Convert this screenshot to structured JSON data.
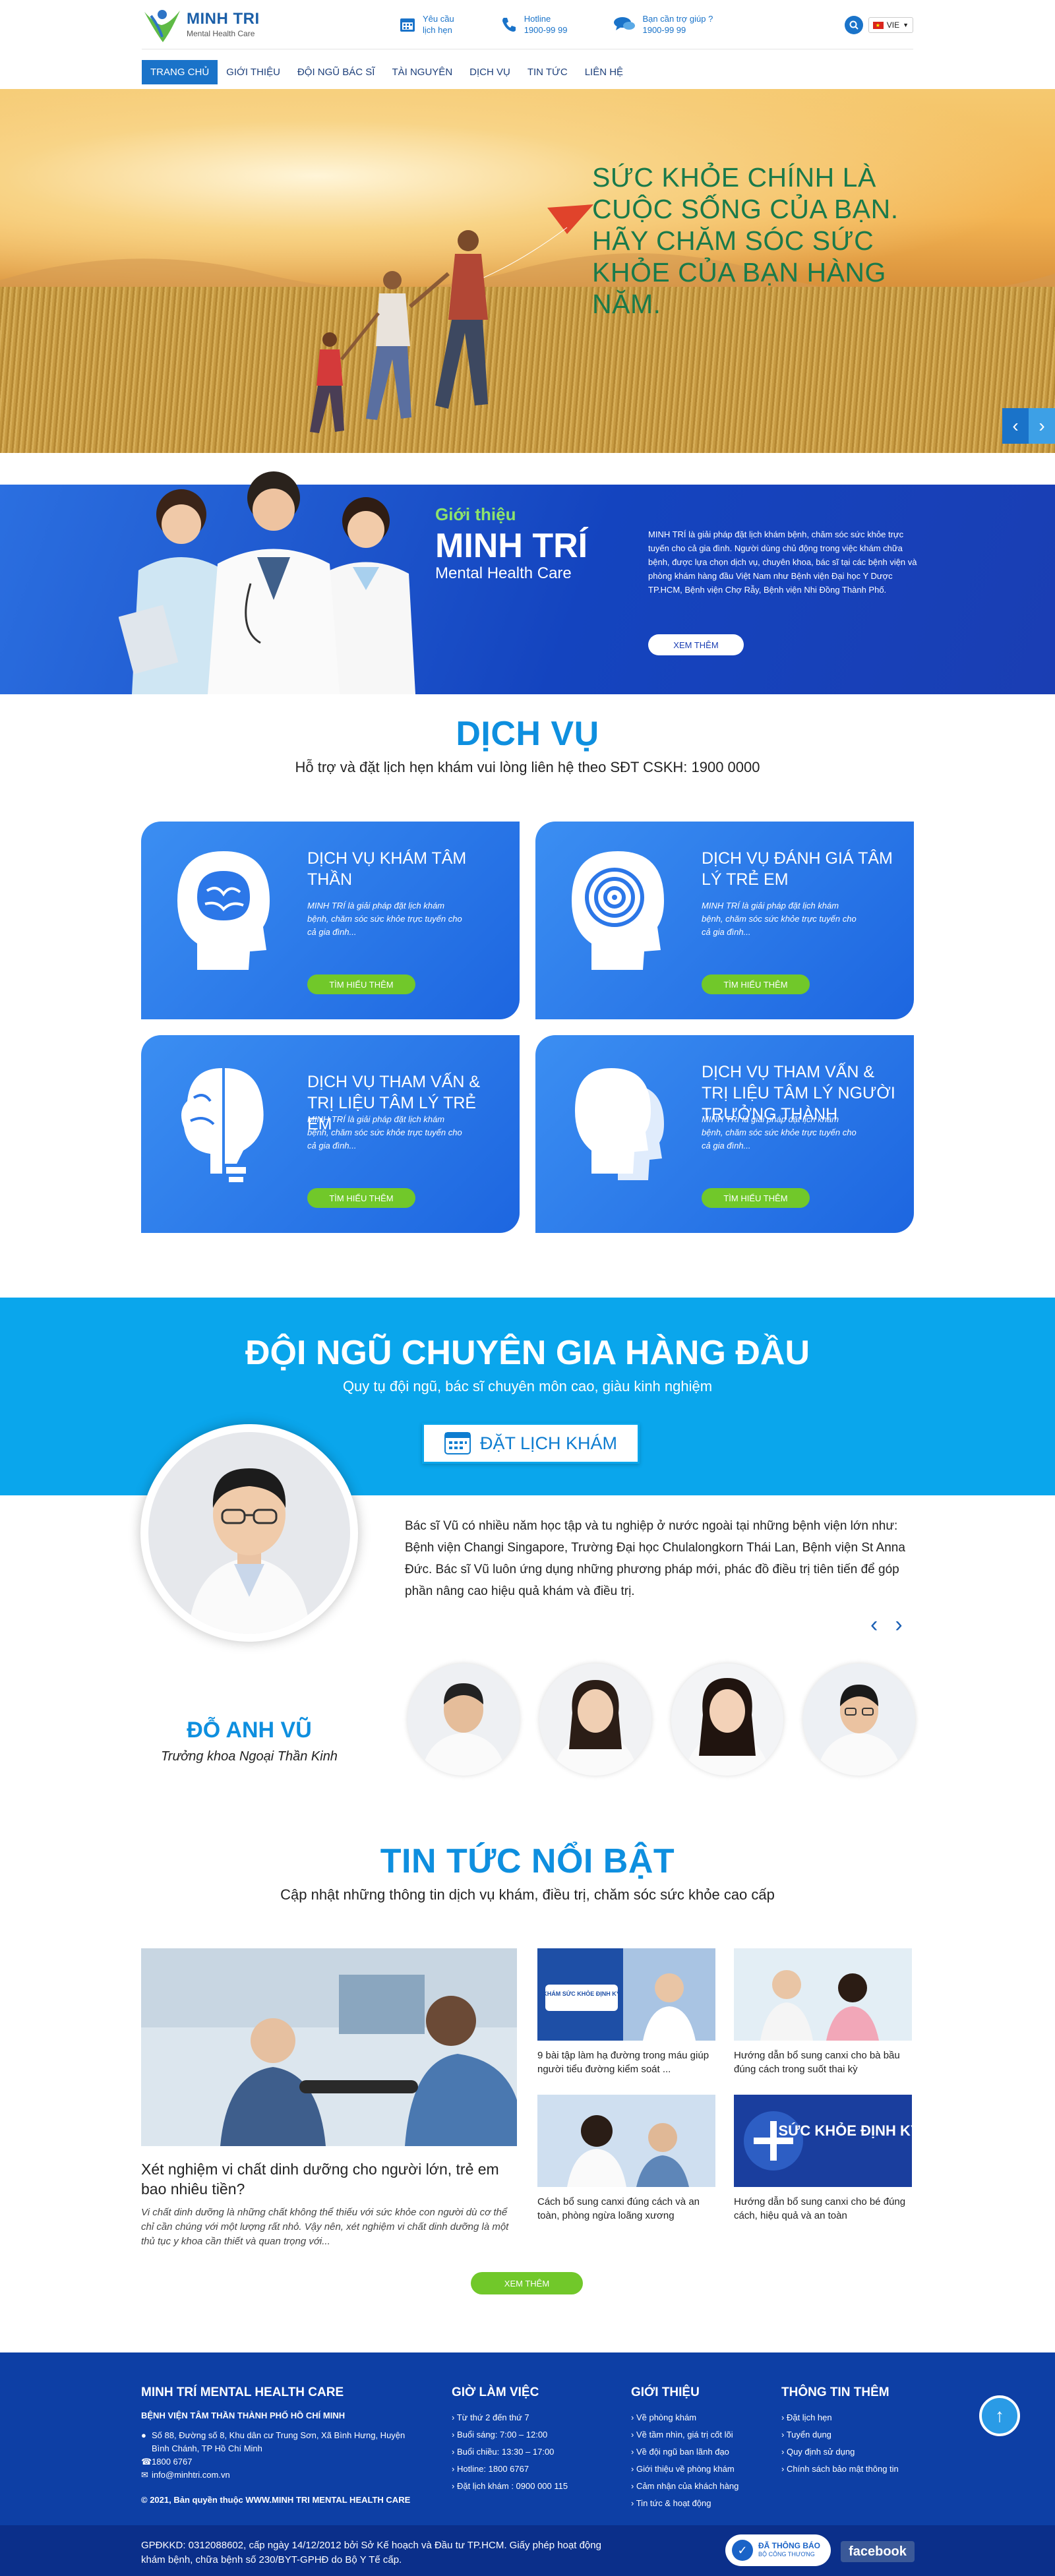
{
  "brand": {
    "name": "MINH TRI",
    "tagline": "Mental Health Care"
  },
  "header": {
    "contacts": [
      {
        "icon": "calendar-icon",
        "label": "Yêu cầu",
        "sub": "lịch hẹn"
      },
      {
        "icon": "phone-icon",
        "label": "Hotline",
        "sub": "1900-99 99"
      },
      {
        "icon": "chat-icon",
        "label": "Bạn cần trợ giúp ?",
        "sub": "1900-99 99"
      }
    ],
    "language": "VIE"
  },
  "nav": {
    "items": [
      "TRANG CHỦ",
      "GIỚI THIỆU",
      "ĐỘI NGŨ BÁC SĨ",
      "TÀI NGUYÊN",
      "DỊCH VỤ",
      "TIN TỨC",
      "LIÊN HỆ"
    ],
    "active": "TRANG CHỦ"
  },
  "hero": {
    "title": "SỨC KHỎE CHÍNH LÀ CUỘC SỐNG CỦA BẠN. HÃY CHĂM SÓC SỨC KHỎE CỦA BẠN HÀNG NĂM.",
    "prev": "‹",
    "next": "›"
  },
  "intro": {
    "label": "Giới thiệu",
    "title": "MINH TRÍ",
    "subtitle": "Mental Health Care",
    "description": "MINH TRÍ là giải pháp đặt lịch khám bệnh, chăm sóc sức khỏe trực tuyến cho cả gia đình. Người dùng chủ động trong việc khám chữa bệnh, được lựa chọn dịch vụ, chuyên khoa, bác sĩ tại các bệnh viện và phòng khám hàng đầu Việt Nam như Bệnh viện Đại học Y Dược TP.HCM, Bệnh viện Chợ Rẫy, Bệnh viện Nhi Đồng Thành Phố.",
    "button": "XEM THÊM"
  },
  "services": {
    "title": "DỊCH VỤ",
    "subtitle": "Hỗ trợ và đặt lịch hẹn khám vui lòng liên hệ theo SĐT CSKH: 1900 0000",
    "items": [
      {
        "name": "DỊCH VỤ KHÁM TÂM THẦN",
        "desc": "MINH TRÍ là giải pháp đặt lịch khám bệnh, chăm sóc sức khỏe trực tuyến cho cả gia đình...",
        "button": "TÌM HIỂU THÊM",
        "icon": "brain-head-icon"
      },
      {
        "name": "DỊCH VỤ ĐÁNH GIÁ TÂM LÝ TRẺ EM",
        "desc": "MINH TRÍ là giải pháp đặt lịch khám bệnh, chăm sóc sức khỏe trực tuyến cho cả gia đình...",
        "button": "TÌM HIỂU THÊM",
        "icon": "maze-head-icon"
      },
      {
        "name": "DỊCH VỤ THAM VẤN & TRỊ LIỆU TÂM LÝ TRẺ EM",
        "desc": "MINH TRÍ là giải pháp đặt lịch khám bệnh, chăm sóc sức khỏe trực tuyến cho cả gia đình...",
        "button": "TÌM HIỂU THÊM",
        "icon": "brain-bulb-icon"
      },
      {
        "name": "DỊCH VỤ THAM VẤN & TRỊ LIỆU TÂM LÝ NGƯỜI TRƯỞNG THÀNH",
        "desc": "MINH TRÍ là giải pháp đặt lịch khám bệnh, chăm sóc sức khỏe trực tuyến cho cả gia đình...",
        "button": "TÌM HIỂU THÊM",
        "icon": "two-heads-icon"
      }
    ]
  },
  "experts": {
    "title": "ĐỘI NGŨ CHUYÊN GIA HÀNG ĐẦU",
    "subtitle": "Quy tụ đội ngũ, bác sĩ chuyên môn cao, giàu kinh nghiệm",
    "book_button": "ĐẶT LỊCH KHÁM",
    "doctor": {
      "name": "ĐỖ ANH VŨ",
      "role": "Trưởng khoa Ngoại Thần Kinh",
      "bio": "Bác sĩ Vũ có nhiều năm học tập và tu nghiệp ở nước ngoài tại những bệnh viện lớn như: Bệnh viện Changi Singapore, Trường Đại học Chulalongkorn Thái Lan, Bệnh viện St Anna Đức. Bác sĩ Vũ luôn ứng dụng những phương pháp mới, phác đồ điều trị tiên tiến để góp phần nâng cao hiệu quả khám và điều trị."
    },
    "prev": "‹",
    "next": "›"
  },
  "news": {
    "title": "TIN TỨC NỔI BẬT",
    "subtitle": "Cập nhật những thông tin dịch vụ khám, điều trị, chăm sóc sức khỏe cao cấp",
    "featured": {
      "title": "Xét nghiệm vi chất dinh dưỡng cho người lớn, trẻ em bao nhiêu tiền?",
      "desc": "Vi chất dinh dưỡng là những chất không thể thiếu với sức khỏe con người dù cơ thể chỉ cần chúng với một lượng rất nhỏ. Vậy nên, xét nghiệm vi chất dinh dưỡng là một thủ tục y khoa cần thiết và quan trọng với..."
    },
    "items": [
      {
        "title": "9 bài tập làm hạ đường trong máu giúp người tiểu đường kiểm soát ...",
        "image_text": "KHÁM SỨC KHỎE ĐỊNH KỲ"
      },
      {
        "title": "Hướng dẫn bổ sung canxi cho bà bầu đúng cách trong suốt thai kỳ",
        "image_text": ""
      },
      {
        "title": "Cách bổ sung canxi đúng cách và an toàn, phòng ngừa loãng xương",
        "image_text": ""
      },
      {
        "title": "Hướng dẫn bổ sung canxi cho bé đúng cách, hiệu quả và an toàn",
        "image_text": "SỨC KHỎE ĐỊNH KỲ"
      }
    ],
    "more_button": "XEM THÊM"
  },
  "footer": {
    "col1": {
      "title": "MINH TRÍ MENTAL HEALTH CARE",
      "subtitle": "BỆNH VIỆN TÂM THẦN THÀNH PHỐ HỒ CHÍ MINH",
      "address": "Số 88, Đường số 8, Khu dân cư Trung Sơn, Xã Bình Hưng, Huyện Bình Chánh, TP Hồ Chí Minh",
      "phone": "1800 6767",
      "email": "info@minhtri.com.vn",
      "copyright": "© 2021, Bản quyền thuộc WWW.MINH TRI MENTAL HEALTH CARE"
    },
    "col2": {
      "title": "GIỜ LÀM VIỆC",
      "items": [
        "Từ thứ 2 đến thứ 7",
        "Buổi sáng: 7:00 – 12:00",
        "Buổi chiều: 13:30 – 17:00",
        "Hotline: 1800 6767",
        "Đặt lịch khám : 0900 000 115"
      ]
    },
    "col3": {
      "title": "GIỚI THIỆU",
      "items": [
        "Về phòng khám",
        "Về tầm nhìn, giá trị cốt lõi",
        "Về đội ngũ ban lãnh đạo",
        "Giới thiệu về phòng khám",
        "Cảm nhận của khách hàng",
        "Tin tức & hoạt động"
      ]
    },
    "col4": {
      "title": "THÔNG TIN THÊM",
      "items": [
        "Đặt lịch hẹn",
        "Tuyển dụng",
        "Quy định sử dụng",
        "Chính sách bảo mật thông tin"
      ]
    },
    "license": "GPĐKKD: 0312088602, cấp ngày 14/12/2012 bởi Sở Kế hoạch và Đầu tư TP.HCM. Giấy phép hoạt động khám bệnh, chữa bệnh số 230/BYT-GPHĐ do Bộ Y Tế cấp.",
    "badge_line1": "ĐÃ THÔNG BÁO",
    "badge_line2": "BỘ CÔNG THƯƠNG",
    "facebook": "facebook",
    "to_top": "↑"
  },
  "colors": {
    "primary": "#1a73c9",
    "accent": "#0aa6ec",
    "green": "#71c82a",
    "footer": "#0d3fa5"
  }
}
